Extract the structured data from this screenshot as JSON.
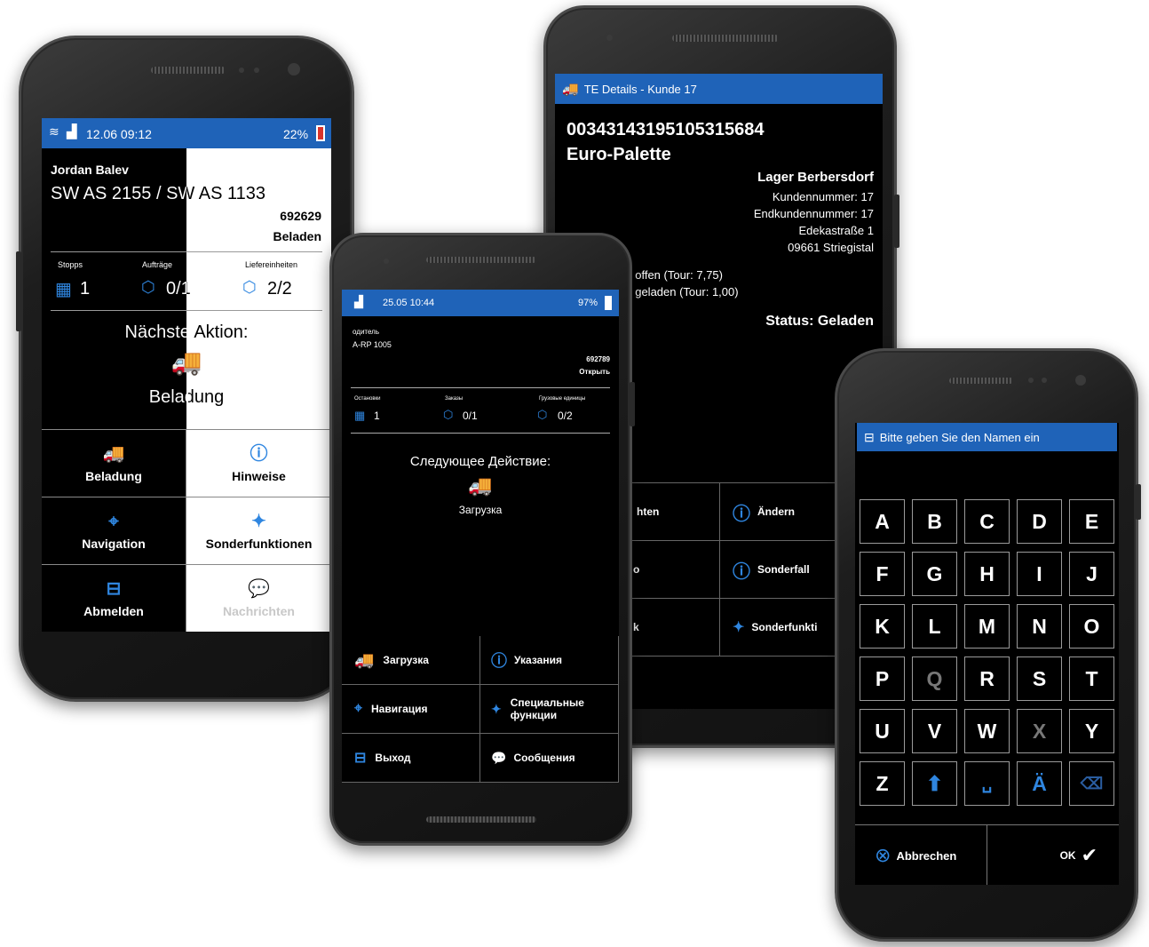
{
  "phone1": {
    "status": {
      "time": "12.06 09:12",
      "battery": "22%"
    },
    "driver": "Jordan Balev",
    "vehicle": "SW AS 2155 / SW AS 1133",
    "tour": "692629",
    "state": "Beladen",
    "stats": [
      {
        "label": "Stopps",
        "value": "1"
      },
      {
        "label": "Aufträge",
        "value": "0/1"
      },
      {
        "label": "Liefereinheiten",
        "value": "2/2"
      }
    ],
    "next_title": "Nächste Aktion:",
    "next_action": "Beladung",
    "tiles": [
      "Beladung",
      "Hinweise",
      "Navigation",
      "Sonderfunktionen",
      "Abmelden",
      "Nachrichten"
    ]
  },
  "phone2": {
    "status": {
      "time": "25.05 10:44",
      "battery": "97%"
    },
    "driver": "одитель",
    "vehicle": "A-RP 1005",
    "tour": "692789",
    "state": "Открыть",
    "stats": [
      {
        "label": "Остановки",
        "value": "1"
      },
      {
        "label": "Заказы",
        "value": "0/1"
      },
      {
        "label": "Грузовые единицы",
        "value": "0/2"
      }
    ],
    "next_title": "Следующее Действие:",
    "next_action": "Загрузка",
    "tiles": [
      "Загрузка",
      "Указания",
      "Навигация",
      "Специальные функции",
      "Выход",
      "Сообщения"
    ]
  },
  "phone3": {
    "title": "TE Details - Kunde 17",
    "number": "00343143195105315684",
    "type": "Euro-Palette",
    "warehouse": "Lager Berbersdorf",
    "kundennummer": "Kundennummer: 17",
    "endkundennummer": "Endkundennummer: 17",
    "street": "Edekastraße 1",
    "city": "09661 Striegistal",
    "offen": ". offen (Tour: 7,75)",
    "geladen": ". geladen (Tour: 1,00)",
    "status": "Status: Geladen",
    "tiles": [
      "hten",
      "Ändern",
      "o",
      "Sonderfall",
      "k",
      "Sonderfunkti"
    ]
  },
  "phone4": {
    "title": "Bitte geben Sie den Namen ein",
    "keys": [
      "A",
      "B",
      "C",
      "D",
      "E",
      "F",
      "G",
      "H",
      "I",
      "J",
      "K",
      "L",
      "M",
      "N",
      "O",
      "P",
      "Q",
      "R",
      "S",
      "T",
      "U",
      "V",
      "W",
      "X",
      "Y",
      "Z",
      "⬆",
      "␣",
      "Ä",
      "⌫"
    ],
    "cancel": "Abbrechen",
    "ok": "OK"
  },
  "colors": {
    "accent": "#1f63b8",
    "icon_blue": "#2f86e0"
  }
}
